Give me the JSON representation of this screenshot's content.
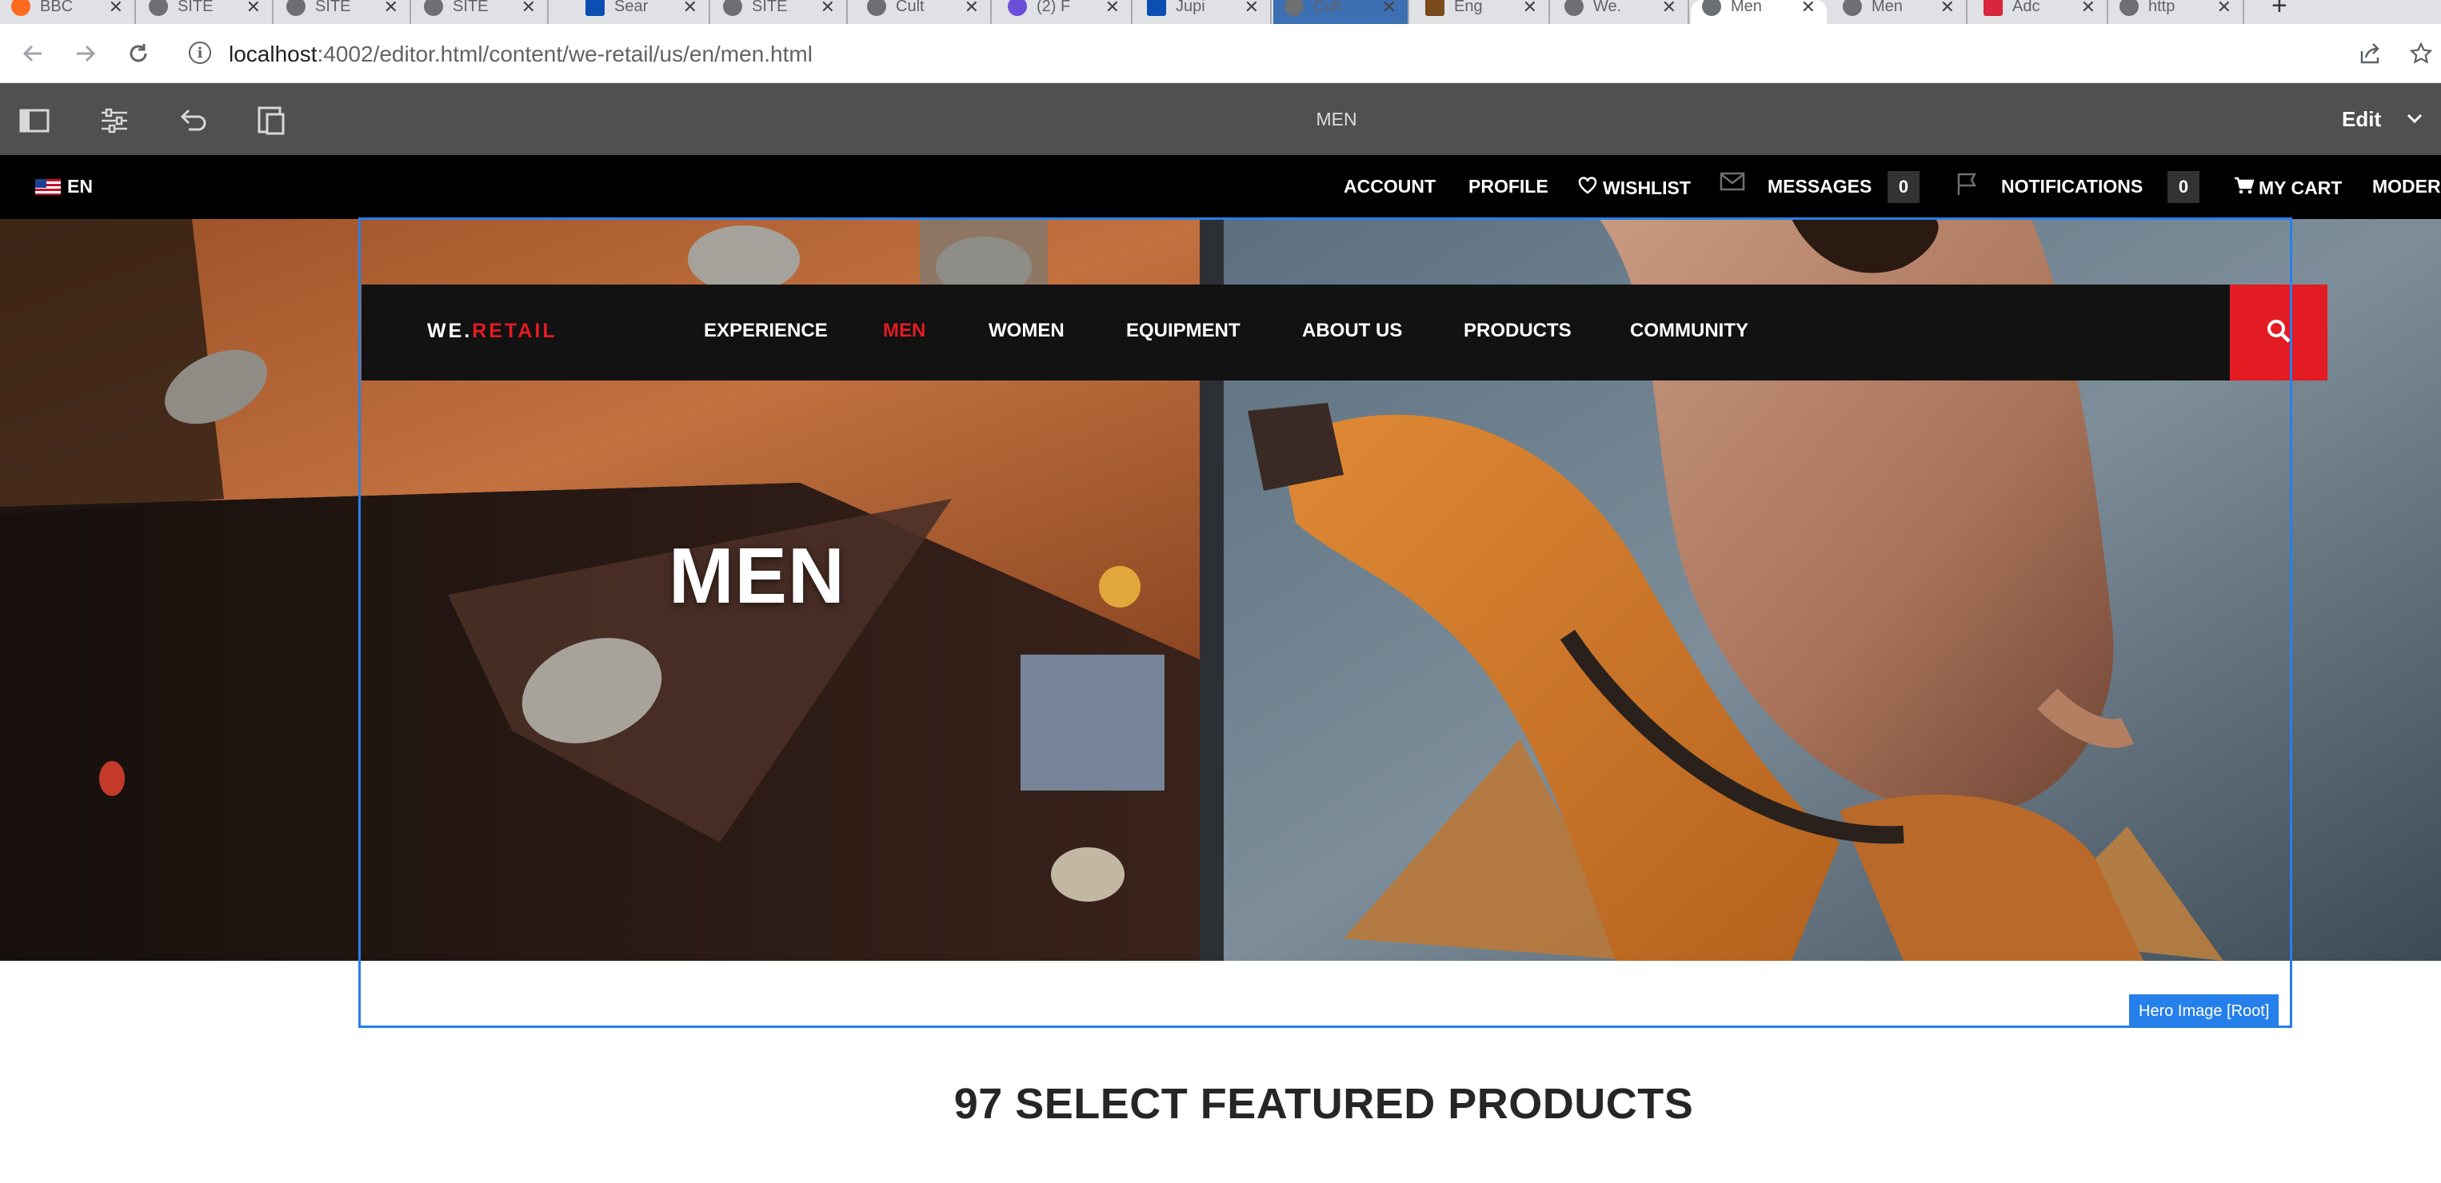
{
  "browser": {
    "tabs": [
      {
        "title": "BBC",
        "favicon": "orange"
      },
      {
        "title": "SITE",
        "favicon": "gray"
      },
      {
        "title": "SITE",
        "favicon": "gray"
      },
      {
        "title": "SITE",
        "favicon": "gray"
      },
      {
        "title": "Sear",
        "favicon": "blue"
      },
      {
        "title": "SITE",
        "favicon": "gray"
      },
      {
        "title": "Cult",
        "favicon": "gray"
      },
      {
        "title": "(2) F",
        "favicon": "purple"
      },
      {
        "title": "Jupi",
        "favicon": "blue"
      },
      {
        "title": "Cult",
        "favicon": "gray"
      },
      {
        "title": "Eng",
        "favicon": "brown"
      },
      {
        "title": "We.",
        "favicon": "gray"
      },
      {
        "title": "Men",
        "favicon": "gray"
      },
      {
        "title": "Men",
        "favicon": "gray"
      },
      {
        "title": "Adc",
        "favicon": "red"
      },
      {
        "title": "http",
        "favicon": "gray"
      }
    ],
    "active_tab_index": 12,
    "new_tab_label": "+",
    "url_host": "localhost",
    "url_rest": ":4002/editor.html/content/we-retail/us/en/men.html"
  },
  "editor": {
    "page_title": "MEN",
    "mode": "Edit"
  },
  "util": {
    "language": "EN",
    "account": "ACCOUNT",
    "profile": "PROFILE",
    "wishlist": "WISHLIST",
    "messages": "MESSAGES",
    "messages_count": "0",
    "notifications": "NOTIFICATIONS",
    "notifications_count": "0",
    "cart": "MY CART",
    "moderation": "MODER"
  },
  "nav": {
    "brand_prefix": "WE.",
    "brand_suffix": "RETAIL",
    "items": [
      "EXPERIENCE",
      "MEN",
      "WOMEN",
      "EQUIPMENT",
      "ABOUT US",
      "PRODUCTS",
      "COMMUNITY"
    ],
    "active_item": "MEN"
  },
  "hero": {
    "title": "MEN",
    "component_label": "Hero Image [Root]"
  },
  "featured": {
    "heading": "97 SELECT FEATURED PRODUCTS"
  },
  "colors": {
    "brand_red": "#e31b23",
    "editor_bar": "#505050",
    "selection_blue": "#2680eb"
  }
}
